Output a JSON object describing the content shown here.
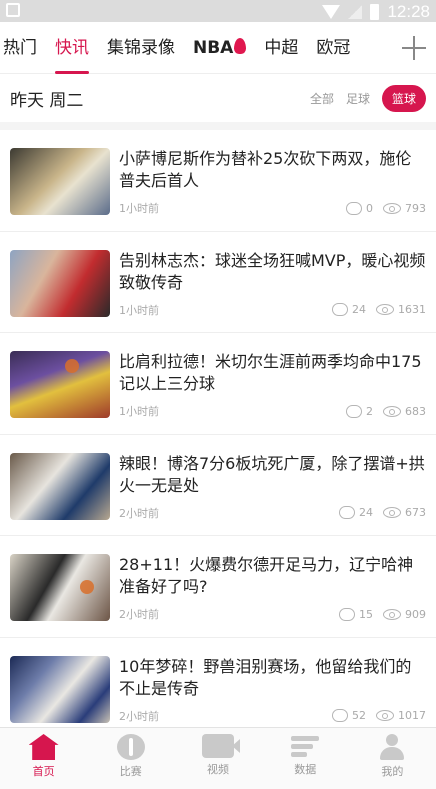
{
  "status_bar": {
    "time": "12:28"
  },
  "top_tabs": [
    {
      "label": "热门",
      "active": false
    },
    {
      "label": "快讯",
      "active": true
    },
    {
      "label": "集锦录像",
      "active": false
    },
    {
      "label": "NBA",
      "active": false,
      "icon": "fire-icon"
    },
    {
      "label": "中超",
      "active": false
    },
    {
      "label": "欧冠",
      "active": false
    }
  ],
  "date_row": {
    "date": "昨天 周二",
    "filters": [
      {
        "label": "全部",
        "active": false
      },
      {
        "label": "足球",
        "active": false
      },
      {
        "label": "篮球",
        "active": true
      }
    ]
  },
  "news": [
    {
      "title": "小萨博尼斯作为替补25次砍下两双，施伦普夫后首人",
      "time": "1小时前",
      "comments": "0",
      "views": "793"
    },
    {
      "title": "告别林志杰：球迷全场狂喊MVP，暖心视频致敬传奇",
      "time": "1小时前",
      "comments": "24",
      "views": "1631"
    },
    {
      "title": "比肩利拉德！米切尔生涯前两季均命中175记以上三分球",
      "time": "1小时前",
      "comments": "2",
      "views": "683"
    },
    {
      "title": "辣眼！博洛7分6板坑死广厦，除了摆谱+拱火一无是处",
      "time": "2小时前",
      "comments": "24",
      "views": "673"
    },
    {
      "title": "28+11！火爆费尔德开足马力，辽宁哈神准备好了吗?",
      "time": "2小时前",
      "comments": "15",
      "views": "909"
    },
    {
      "title": "10年梦碎！野兽泪别赛场，他留给我们的不止是传奇",
      "time": "2小时前",
      "comments": "52",
      "views": "1017"
    }
  ],
  "bottom_nav": [
    {
      "label": "首页",
      "active": true,
      "icon": "home-icon"
    },
    {
      "label": "比赛",
      "active": false,
      "icon": "match-icon"
    },
    {
      "label": "视频",
      "active": false,
      "icon": "video-icon"
    },
    {
      "label": "数据",
      "active": false,
      "icon": "data-icon"
    },
    {
      "label": "我的",
      "active": false,
      "icon": "profile-icon"
    }
  ],
  "colors": {
    "accent": "#d6164e",
    "muted": "#999999"
  }
}
